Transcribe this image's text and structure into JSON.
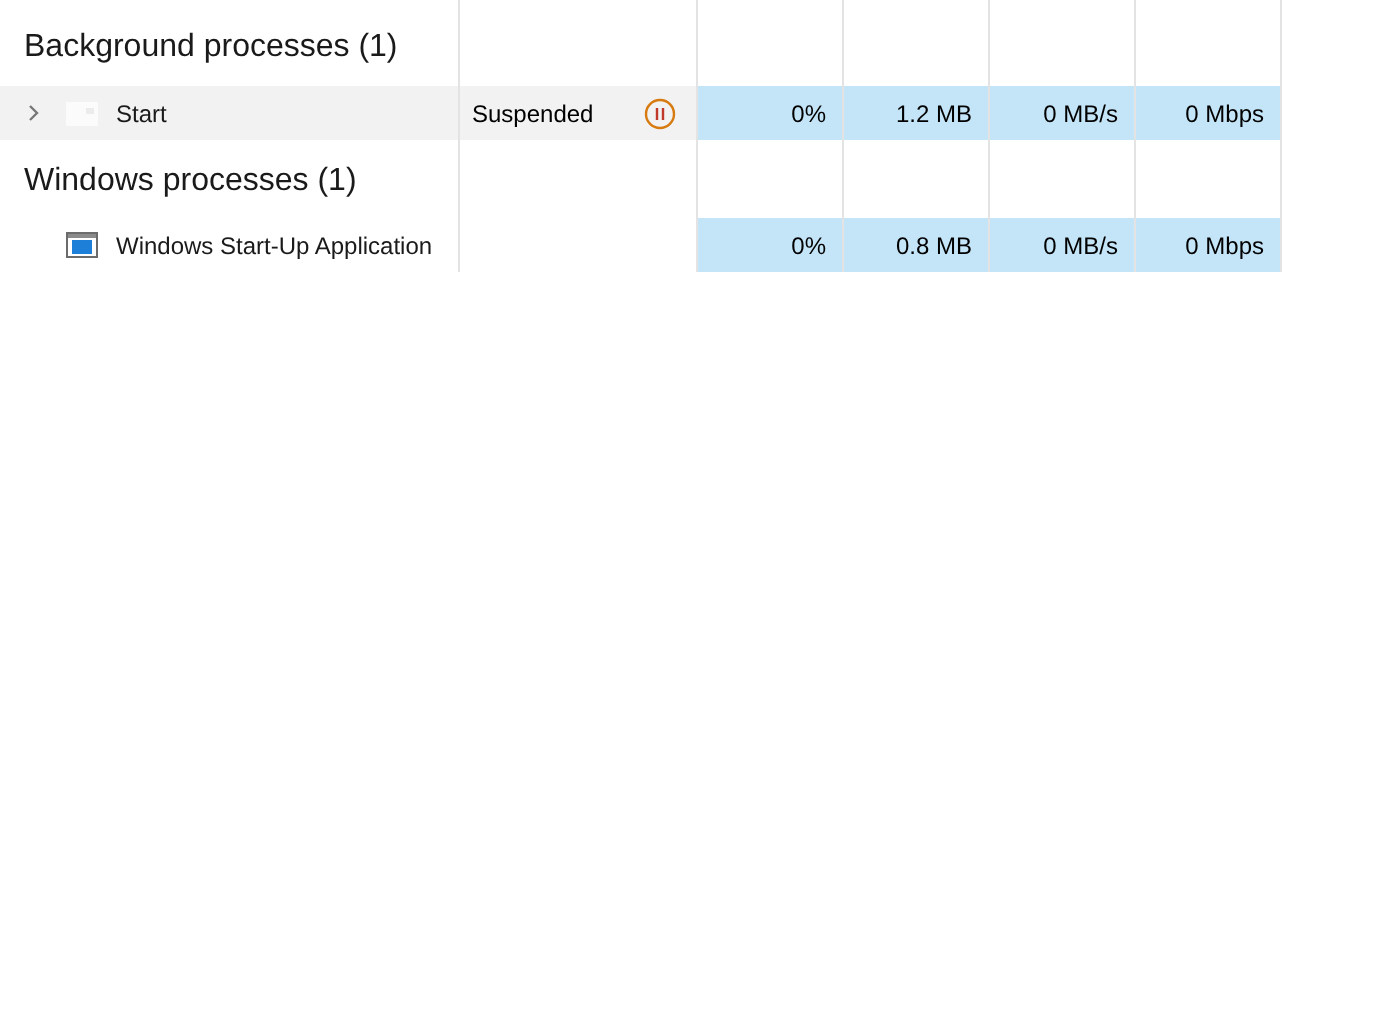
{
  "groups": [
    {
      "title": "Background processes (1)",
      "rows": [
        {
          "name": "Start",
          "expandable": true,
          "highlighted": true,
          "status": "Suspended",
          "suspended": true,
          "cpu": "0%",
          "memory": "1.2 MB",
          "disk": "0 MB/s",
          "network": "0 Mbps"
        }
      ]
    },
    {
      "title": "Windows processes (1)",
      "rows": [
        {
          "name": "Windows Start-Up Application",
          "expandable": false,
          "highlighted": false,
          "cpu": "0%",
          "memory": "0.8 MB",
          "disk": "0 MB/s",
          "network": "0 Mbps"
        }
      ]
    }
  ]
}
